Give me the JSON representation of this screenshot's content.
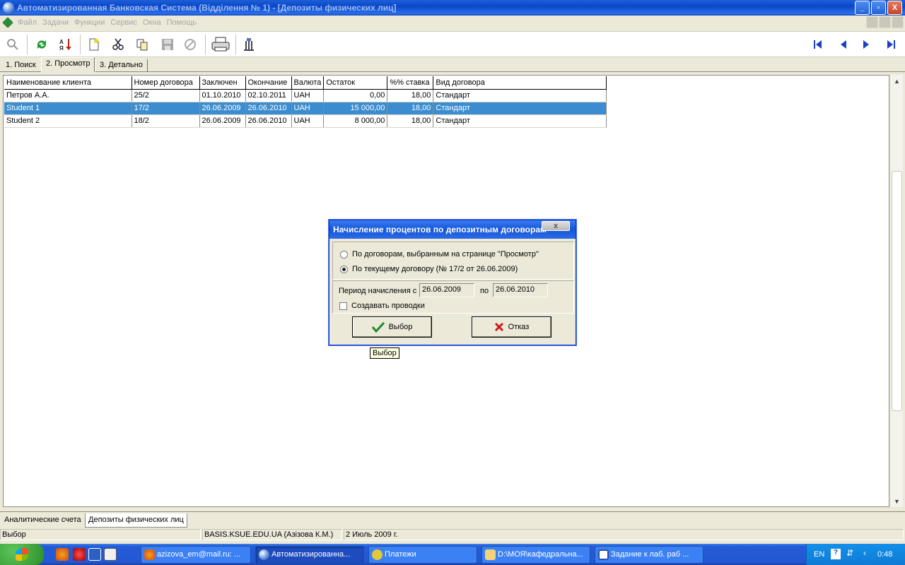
{
  "window": {
    "title": "Автоматизированная Банковская Система (Відділення № 1) - [Депозиты физических лиц]",
    "controls": [
      "_",
      "▫",
      "X"
    ]
  },
  "menu": [
    "Файл",
    "Задачи",
    "Функции",
    "Сервис",
    "Окна",
    "Помощь"
  ],
  "toolbar": {
    "icons": [
      "zoom-icon",
      "refresh-icon",
      "sort-icon",
      "new-document-icon",
      "cut-icon",
      "copy-icon",
      "save-icon",
      "cancel-icon",
      "print-icon",
      "tool-icon"
    ],
    "nav": [
      "first-record-icon",
      "prev-record-icon",
      "next-record-icon",
      "last-record-icon"
    ]
  },
  "tabs": [
    {
      "label": "1. Поиск"
    },
    {
      "label": "2. Просмотр"
    },
    {
      "label": "3. Детально"
    }
  ],
  "table": {
    "columns": [
      "Наименование клиента",
      "Номер договора",
      "Заключен",
      "Окончание",
      "Валюта",
      "Остаток",
      "%% ставка",
      "Вид договора"
    ],
    "rows": [
      [
        "Петров А.А.",
        "25/2",
        "01.10.2010",
        "02.10.2011",
        "UAH",
        "0,00",
        "18,00",
        "Стандарт"
      ],
      [
        "Student 1",
        "17/2",
        "26.06.2009",
        "26.06.2010",
        "UAH",
        "15 000,00",
        "18,00",
        "Стандарт"
      ],
      [
        "Student 2",
        "18/2",
        "26.06.2009",
        "26.06.2010",
        "UAH",
        "8 000,00",
        "18,00",
        "Стандарт"
      ]
    ],
    "selected_row": 1
  },
  "dialog": {
    "title": "Начисление процентов по депозитным договорам",
    "close": "x",
    "radio1": "По договорам, выбранным на странице \"Просмотр\"",
    "radio2": "По текущему договору (№ 17/2 от 26.06.2009)",
    "period_label": "Период начисления с",
    "date_from": "26.06.2009",
    "to_label": "по",
    "date_to": "26.06.2010",
    "checkbox_label": "Создавать проводки",
    "ok_label": "Выбор",
    "cancel_label": "Отказ"
  },
  "tooltip": "Выбор",
  "bottom_tabs": [
    "Аналитические счета",
    "Депозиты физических лиц"
  ],
  "status": {
    "panel1": "Выбор",
    "panel2": "BASIS.KSUE.EDU.UA (Азізова К.М.)",
    "panel3": "2 Июль 2009 г."
  },
  "taskbar": {
    "tasks": [
      {
        "label": "azizova_em@mail.ru: ...",
        "icon": "firefox-icon"
      },
      {
        "label": "Автоматизированна...",
        "icon": "app-icon"
      },
      {
        "label": "Платежи",
        "icon": "payments-icon"
      },
      {
        "label": "D:\\МОЯ\\кафедральна...",
        "icon": "folder-icon"
      },
      {
        "label": "Задание к лаб. раб ...",
        "icon": "word-icon"
      }
    ],
    "lang": "EN",
    "clock": "0:48"
  },
  "colors": {
    "selection": "#3b8dd0",
    "titlebar": "#0a47c8",
    "nav_arrows": "#1a3fc4"
  }
}
